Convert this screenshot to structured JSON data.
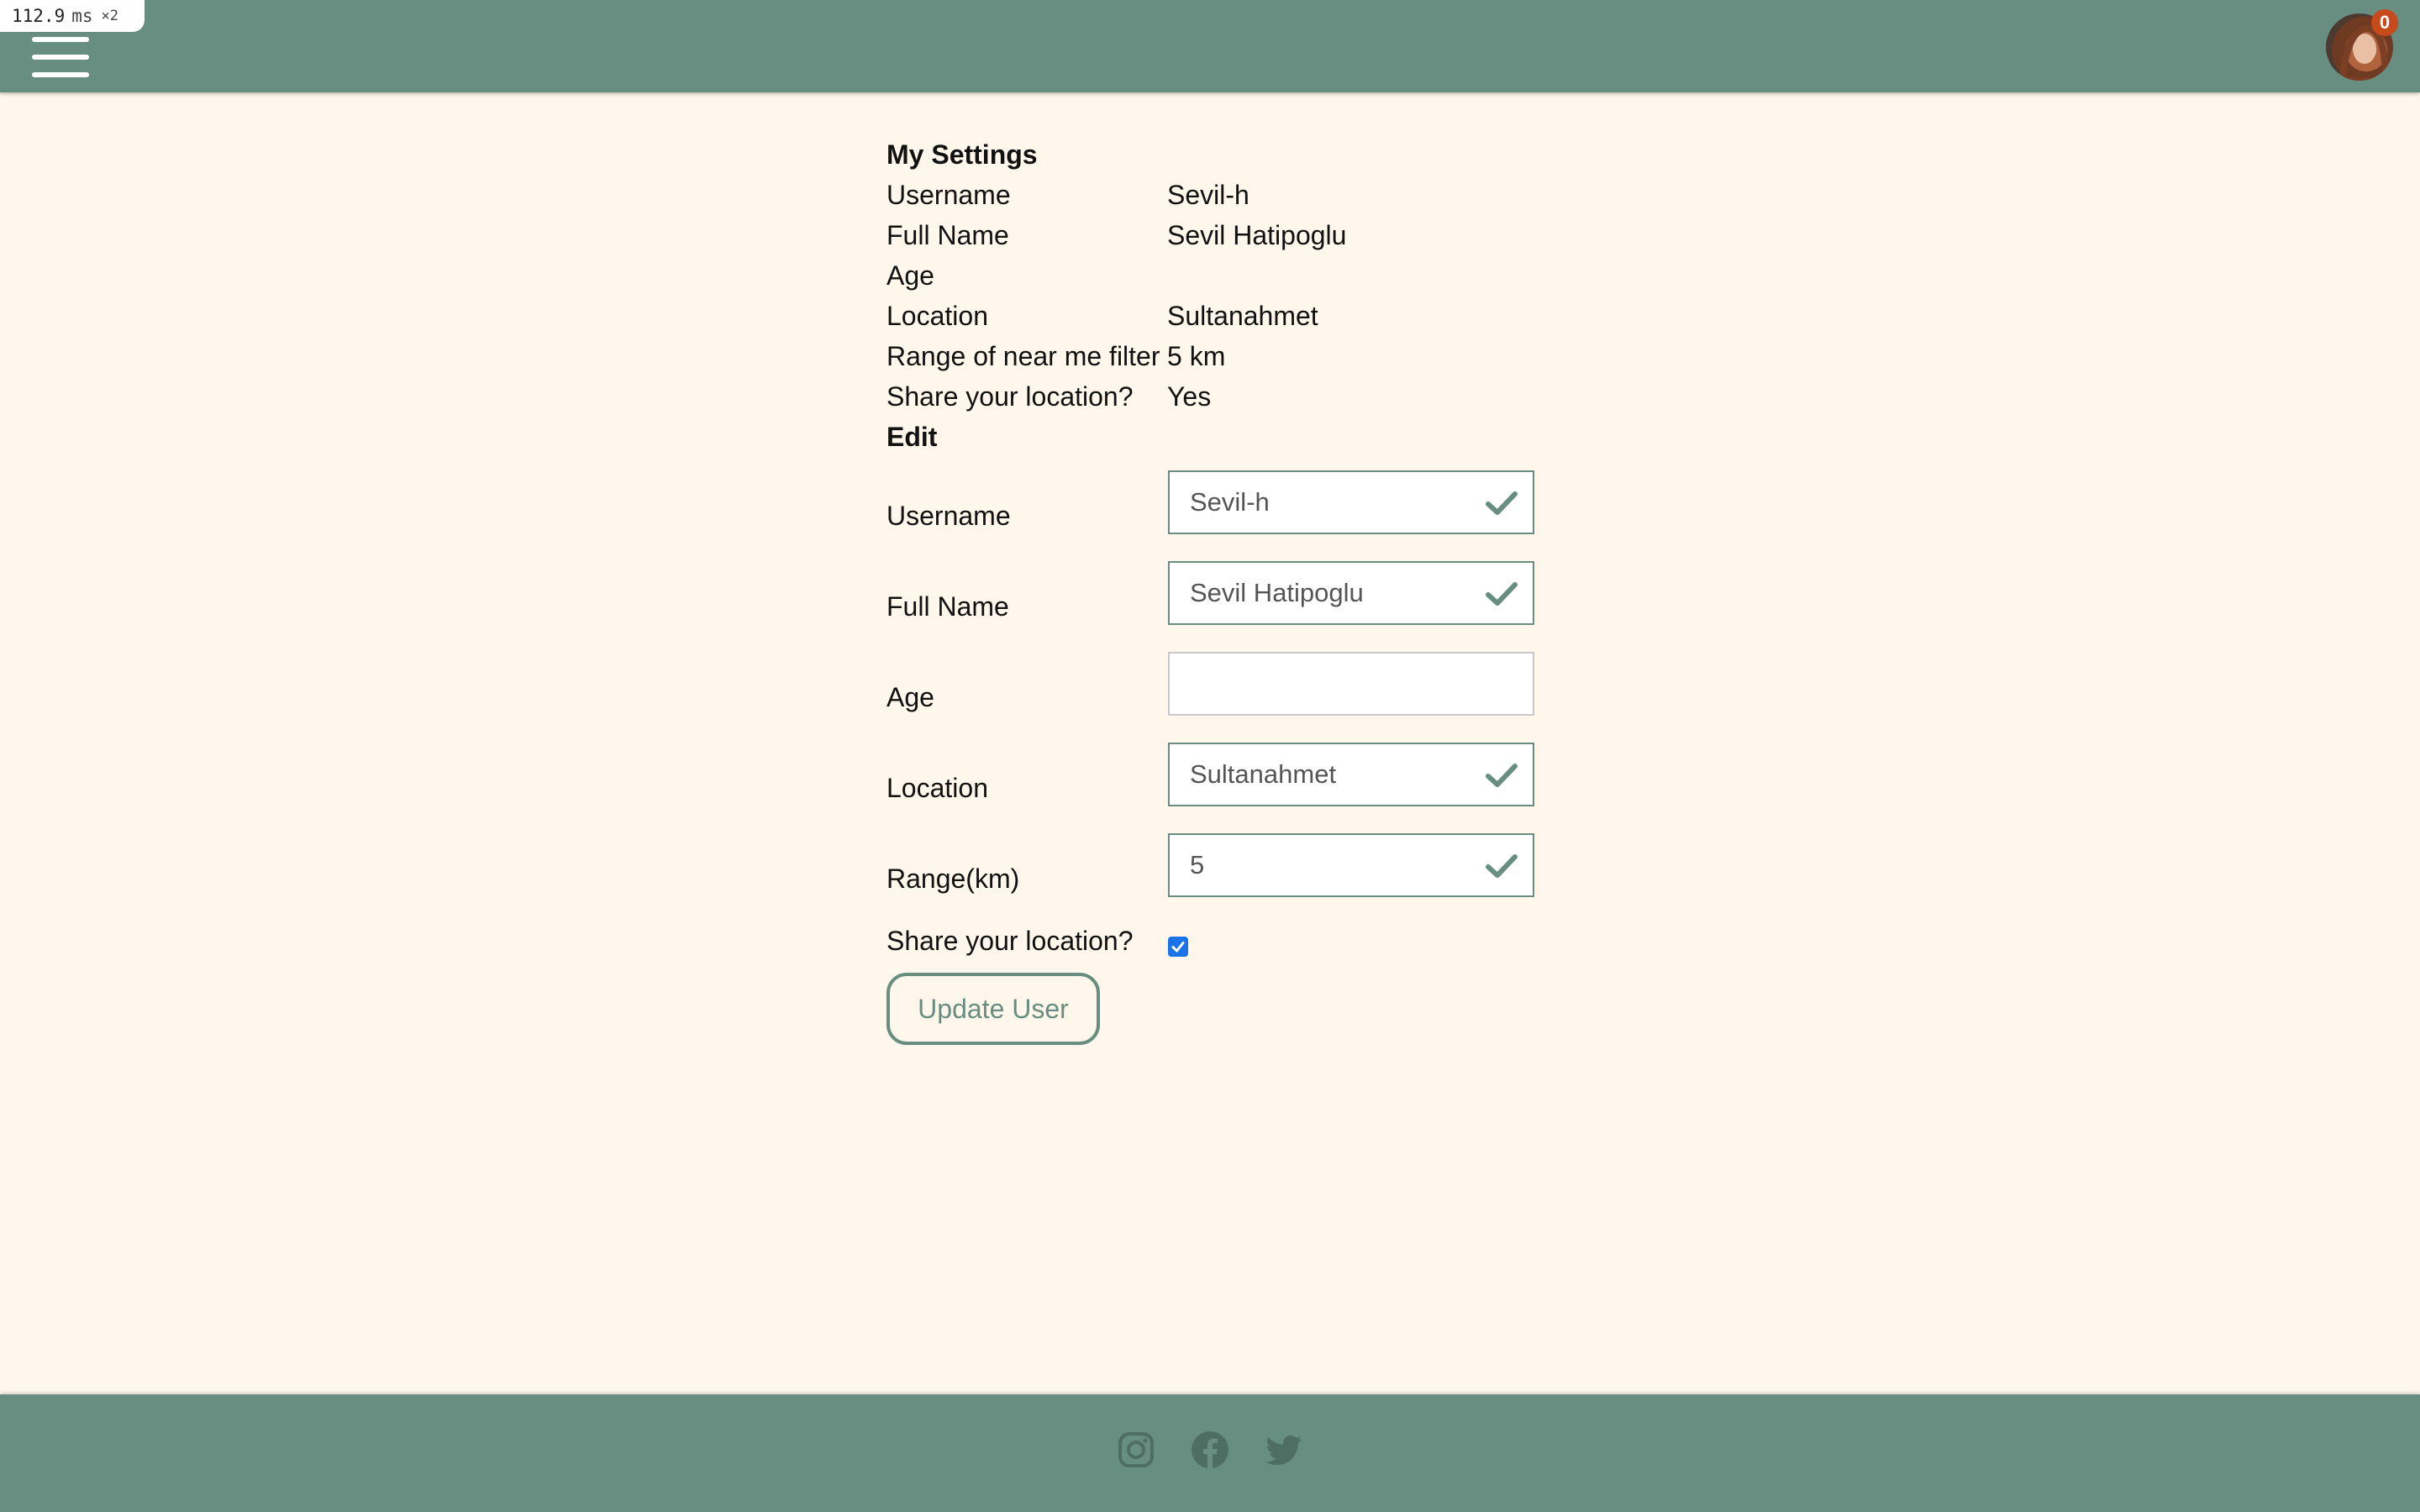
{
  "perf_overlay": {
    "value": "112.9",
    "unit": "ms",
    "multiplier": "×2"
  },
  "header": {
    "menu_icon": "hamburger-menu-icon",
    "notification_count": "0"
  },
  "settings": {
    "title": "My Settings",
    "rows": [
      {
        "label": "Username",
        "value": "Sevil-h"
      },
      {
        "label": "Full Name",
        "value": "Sevil Hatipoglu"
      },
      {
        "label": "Age",
        "value": ""
      },
      {
        "label": "Location",
        "value": "Sultanahmet"
      },
      {
        "label": "Range of near me filter",
        "value": "5 km"
      },
      {
        "label": "Share your location?",
        "value": "Yes"
      }
    ]
  },
  "edit": {
    "title": "Edit",
    "fields": [
      {
        "label": "Username",
        "value": "Sevil-h",
        "valid": true
      },
      {
        "label": "Full Name",
        "value": "Sevil Hatipoglu",
        "valid": true
      },
      {
        "label": "Age",
        "value": "",
        "valid": false
      },
      {
        "label": "Location",
        "value": "Sultanahmet",
        "valid": true
      },
      {
        "label": "Range(km)",
        "value": "5",
        "valid": true
      }
    ],
    "share_label": "Share your location?",
    "share_checked": true,
    "submit_label": "Update User"
  },
  "footer": {
    "social": [
      "instagram-icon",
      "facebook-icon",
      "twitter-icon"
    ]
  },
  "colors": {
    "accent": "#678e80",
    "background": "#fff7ec",
    "badge": "#c64a1c",
    "checkbox": "#1a73e8"
  }
}
